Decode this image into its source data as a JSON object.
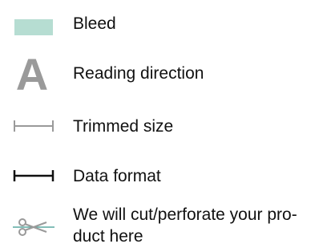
{
  "legend": {
    "items": [
      {
        "icon": "bleed-swatch-icon",
        "label": "Bleed"
      },
      {
        "icon": "reading-direction-icon",
        "glyph": "A",
        "label": "Reading direction"
      },
      {
        "icon": "trimmed-size-icon",
        "label": "Trimmed size"
      },
      {
        "icon": "data-format-icon",
        "label": "Data format"
      },
      {
        "icon": "scissors-icon",
        "label_line1": "We will cut/perforate your pro-",
        "label_line2": "duct here"
      }
    ]
  },
  "colors": {
    "bleed": "#b6ddd2",
    "reading_glyph": "#9a9a9a",
    "trimmed_line": "#9a9a9a",
    "data_format_line": "#111111",
    "scissors": "#9a9a9a",
    "cut_line": "#5aa9a0",
    "text": "#111111"
  }
}
